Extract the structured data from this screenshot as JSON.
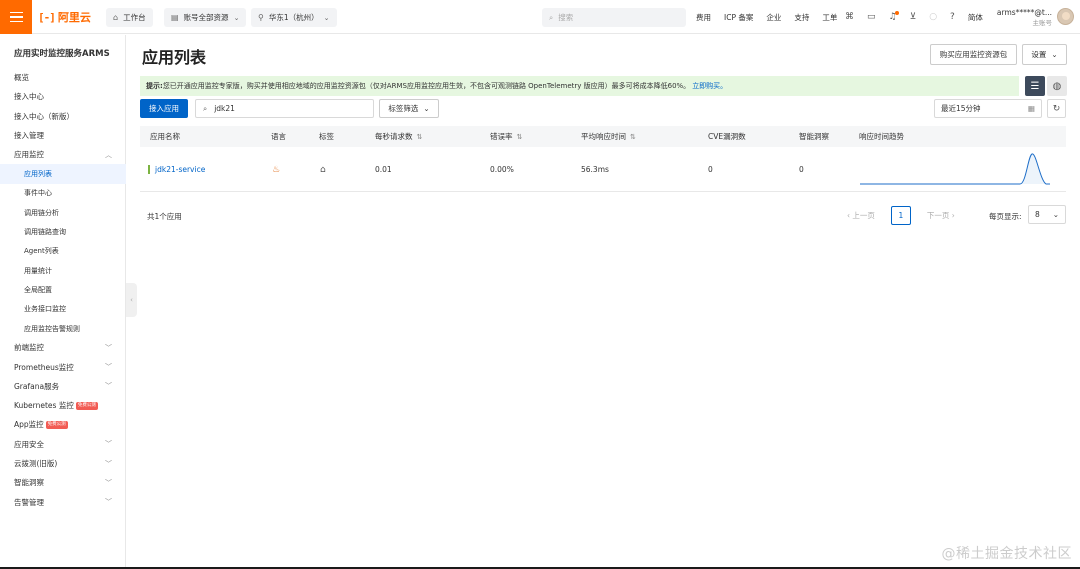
{
  "topbar": {
    "logo_mark": "[-]",
    "logo_text": "阿里云",
    "workbench": "工作台",
    "resource_group": "账号全部资源",
    "region": "华东1（杭州）",
    "search_placeholder": "搜索",
    "links": [
      "费用",
      "ICP 备案",
      "企业",
      "支持",
      "工单"
    ],
    "language": "简体",
    "account_name": "arms*****@t...",
    "account_sub": "主账号",
    "brand_color": "#ff6a00"
  },
  "sidebar": {
    "title": "应用实时监控服务ARMS",
    "items": [
      {
        "label": "概览",
        "level": 0
      },
      {
        "label": "接入中心",
        "level": 0
      },
      {
        "label": "接入中心（新版）",
        "level": 0
      },
      {
        "label": "接入管理",
        "level": 0
      },
      {
        "label": "应用监控",
        "level": 0,
        "expanded": true
      },
      {
        "label": "应用列表",
        "level": 1,
        "active": true
      },
      {
        "label": "事件中心",
        "level": 1
      },
      {
        "label": "调用链分析",
        "level": 1
      },
      {
        "label": "调用链路查询",
        "level": 1
      },
      {
        "label": "Agent列表",
        "level": 1
      },
      {
        "label": "用量统计",
        "level": 1
      },
      {
        "label": "全局配置",
        "level": 1
      },
      {
        "label": "业务接口监控",
        "level": 1
      },
      {
        "label": "应用监控告警规则",
        "level": 1
      },
      {
        "label": "前端监控",
        "level": 0,
        "expandable": true
      },
      {
        "label": "Prometheus监控",
        "level": 0,
        "expandable": true
      },
      {
        "label": "Grafana服务",
        "level": 0,
        "expandable": true
      },
      {
        "label": "Kubernetes 监控",
        "level": 0,
        "tag": "免费公测"
      },
      {
        "label": "App监控",
        "level": 0,
        "tag": "免费公测"
      },
      {
        "label": "应用安全",
        "level": 0,
        "expandable": true
      },
      {
        "label": "云拨测(旧版)",
        "level": 0,
        "expandable": true
      },
      {
        "label": "智能洞察",
        "level": 0,
        "expandable": true
      },
      {
        "label": "告警管理",
        "level": 0,
        "expandable": true
      }
    ]
  },
  "main": {
    "title": "应用列表",
    "buy_button": "购买应用监控资源包",
    "settings_button": "设置",
    "notice_prefix": "提示:",
    "notice_text": "您已开通应用监控专家版，购买并使用相应地域的应用监控资源包（仅对ARMS应用监控应用生效，不包含可观测链路 OpenTelemetry 版应用）最多可将成本降低60%。",
    "notice_link": "立即购买。",
    "add_app_button": "接入应用",
    "search_value": "jdk21",
    "tag_filter": "标签筛选",
    "time_range": "最近15分钟",
    "columns": [
      "应用名称",
      "语言",
      "标签",
      "每秒请求数",
      "错误率",
      "平均响应时间",
      "CVE漏洞数",
      "智能洞察",
      "响应时间趋势"
    ],
    "rows": [
      {
        "name": "jdk21-service",
        "rps": "0.01",
        "error_rate": "0.00%",
        "avg_rt": "56.3ms",
        "cve": "0",
        "insight": "0"
      }
    ],
    "total": "共1个应用",
    "prev": "上一页",
    "next": "下一页",
    "current_page": "1",
    "per_page_label": "每页显示:",
    "per_page": "8"
  },
  "watermark": "@稀土掘金技术社区"
}
